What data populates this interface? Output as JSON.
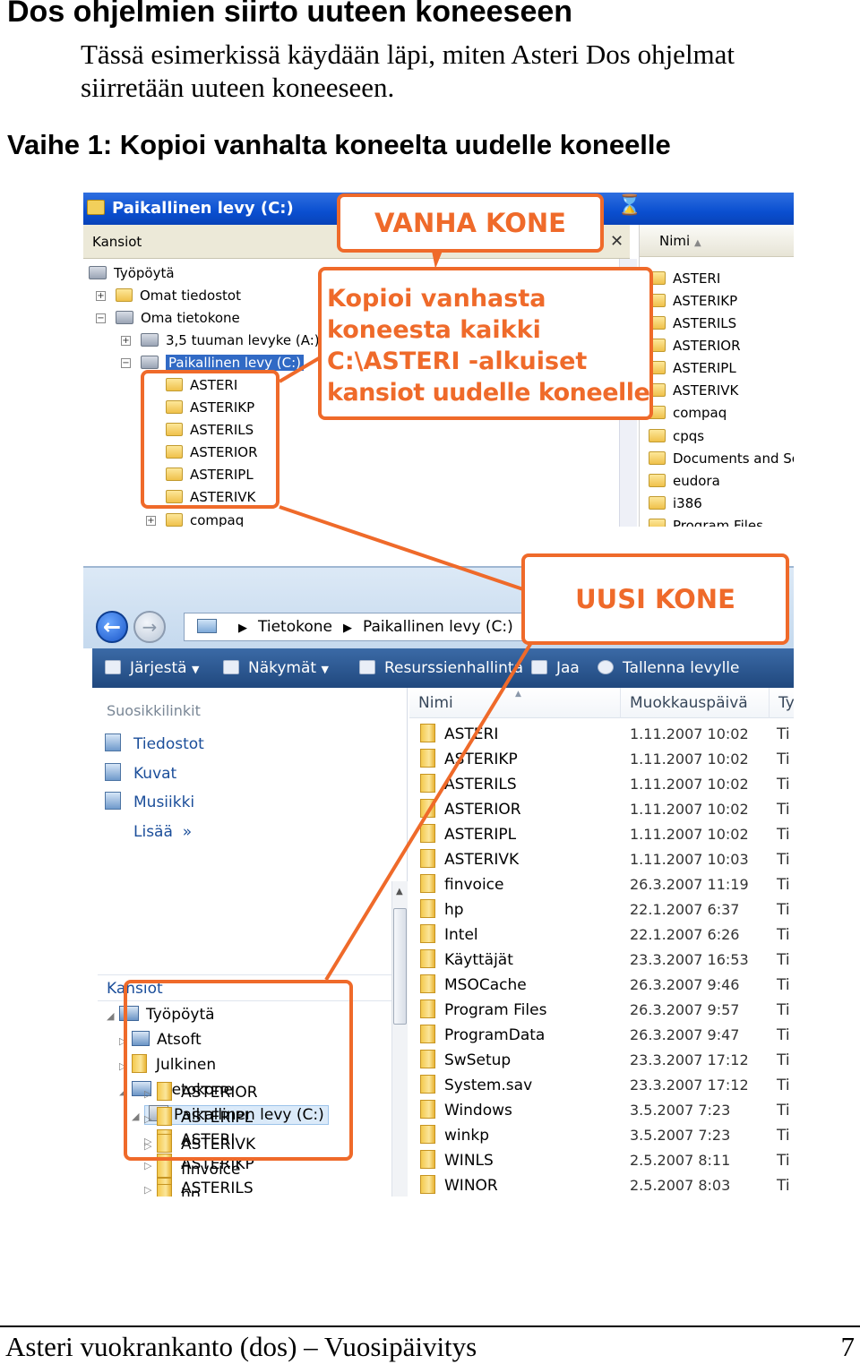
{
  "heading": "Dos ohjelmien siirto uuteen koneeseen",
  "intro": "Tässä esimerkissä käydään läpi, miten Asteri Dos ohjelmat siirretään uuteen koneeseen.",
  "step_heading": "Vaihe 1: Kopioi vanhalta koneelta uudelle koneelle",
  "old_pc": {
    "title": "Paikallinen levy (C:)",
    "pane_header": "Kansiot",
    "close_glyph": "✕",
    "tree": [
      "Työpöytä",
      "Omat tiedostot",
      "Oma tietokone",
      "3,5 tuuman levyke (A:)",
      "Paikallinen levy (C:)",
      "ASTERI",
      "ASTERIKP",
      "ASTERILS",
      "ASTERIOR",
      "ASTERIPL",
      "ASTERIVK",
      "compaq"
    ],
    "list_header": "Nimi",
    "list": [
      "ASTERI",
      "ASTERIKP",
      "ASTERILS",
      "ASTERIOR",
      "ASTERIPL",
      "ASTERIVK",
      "compaq",
      "cpqs",
      "Documents and Set",
      "eudora",
      "i386",
      "Program Files"
    ]
  },
  "new_pc": {
    "address": [
      "Tietokone",
      "Paikallinen levy (C:)"
    ],
    "toolbar": [
      "Järjestä",
      "Näkymät",
      "Resurssienhallinta",
      "Jaa",
      "Tallenna levylle"
    ],
    "favorites_title": "Suosikkilinkit",
    "favorites": [
      "Tiedostot",
      "Kuvat",
      "Musiikki"
    ],
    "more": "Lisää",
    "more_glyph": "»",
    "folders_title": "Kansiot",
    "tree": [
      "Työpöytä",
      "Atsoft",
      "Julkinen",
      "Tietokone",
      "Paikallinen levy (C:)",
      "ASTERI",
      "ASTERIKP",
      "ASTERILS",
      "ASTERIOR",
      "ASTERIPL",
      "ASTERIVK",
      "finvoice",
      "hp"
    ],
    "columns": [
      "Nimi",
      "Muokkauspäivä",
      "Ty"
    ],
    "files": [
      {
        "name": "ASTERI",
        "date": "1.11.2007 10:02",
        "type": "Ti"
      },
      {
        "name": "ASTERIKP",
        "date": "1.11.2007 10:02",
        "type": "Ti"
      },
      {
        "name": "ASTERILS",
        "date": "1.11.2007 10:02",
        "type": "Ti"
      },
      {
        "name": "ASTERIOR",
        "date": "1.11.2007 10:02",
        "type": "Ti"
      },
      {
        "name": "ASTERIPL",
        "date": "1.11.2007 10:02",
        "type": "Ti"
      },
      {
        "name": "ASTERIVK",
        "date": "1.11.2007 10:03",
        "type": "Ti"
      },
      {
        "name": "finvoice",
        "date": "26.3.2007 11:19",
        "type": "Ti"
      },
      {
        "name": "hp",
        "date": "22.1.2007 6:37",
        "type": "Ti"
      },
      {
        "name": "Intel",
        "date": "22.1.2007 6:26",
        "type": "Ti"
      },
      {
        "name": "Käyttäjät",
        "date": "23.3.2007 16:53",
        "type": "Ti"
      },
      {
        "name": "MSOCache",
        "date": "26.3.2007 9:46",
        "type": "Ti"
      },
      {
        "name": "Program Files",
        "date": "26.3.2007 9:57",
        "type": "Ti"
      },
      {
        "name": "ProgramData",
        "date": "26.3.2007 9:47",
        "type": "Ti"
      },
      {
        "name": "SwSetup",
        "date": "23.3.2007 17:12",
        "type": "Ti"
      },
      {
        "name": "System.sav",
        "date": "23.3.2007 17:12",
        "type": "Ti"
      },
      {
        "name": "Windows",
        "date": "3.5.2007 7:23",
        "type": "Ti"
      },
      {
        "name": "winkp",
        "date": "3.5.2007 7:23",
        "type": "Ti"
      },
      {
        "name": "WINLS",
        "date": "2.5.2007 8:11",
        "type": "Ti"
      },
      {
        "name": "WINOR",
        "date": "2.5.2007 8:03",
        "type": "Ti"
      }
    ]
  },
  "callouts": {
    "old": "VANHA KONE",
    "instruction_lines": [
      "Kopioi vanhasta",
      "koneesta kaikki",
      "C:\\ASTERI -alkuiset",
      "kansiot uudelle koneelle"
    ],
    "new": "UUSI KONE"
  },
  "colors": {
    "accent": "#ef6a2a",
    "xp_title": "#0a4fd0",
    "vista_toolbar": "#20487e"
  },
  "footer": {
    "title": "Asteri vuokrankanto (dos) – Vuosipäivitys",
    "page": "7"
  }
}
